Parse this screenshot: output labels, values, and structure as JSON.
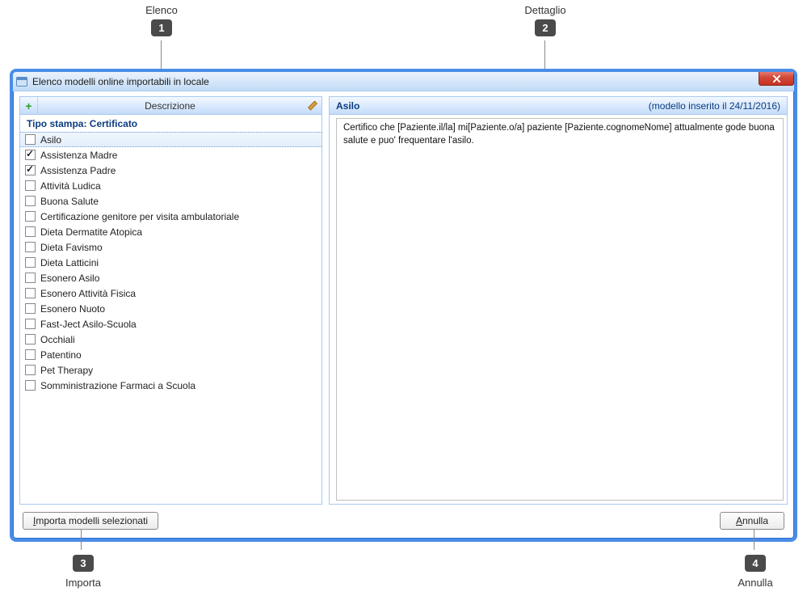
{
  "annotations": {
    "top_left": "Elenco",
    "top_right": "Dettaglio",
    "badge1": "1",
    "badge2": "2",
    "badge3": "3",
    "badge4": "4",
    "bottom_left": "Importa",
    "bottom_right": "Annulla"
  },
  "window": {
    "title": "Elenco modelli online importabili in locale"
  },
  "list": {
    "header": "Descrizione",
    "group_label_prefix": "Tipo stampa: ",
    "group_value": "Certificato",
    "items": [
      {
        "label": "Asilo",
        "checked": false,
        "selected": true
      },
      {
        "label": "Assistenza Madre",
        "checked": true,
        "selected": false
      },
      {
        "label": "Assistenza Padre",
        "checked": true,
        "selected": false
      },
      {
        "label": "Attività  Ludica",
        "checked": false,
        "selected": false
      },
      {
        "label": "Buona Salute",
        "checked": false,
        "selected": false
      },
      {
        "label": "Certificazione genitore per visita ambulatoriale",
        "checked": false,
        "selected": false
      },
      {
        "label": "Dieta Dermatite Atopica",
        "checked": false,
        "selected": false
      },
      {
        "label": "Dieta Favismo",
        "checked": false,
        "selected": false
      },
      {
        "label": "Dieta Latticini",
        "checked": false,
        "selected": false
      },
      {
        "label": "Esonero Asilo",
        "checked": false,
        "selected": false
      },
      {
        "label": "Esonero Attività  Fisica",
        "checked": false,
        "selected": false
      },
      {
        "label": "Esonero Nuoto",
        "checked": false,
        "selected": false
      },
      {
        "label": "Fast-Ject Asilo-Scuola",
        "checked": false,
        "selected": false
      },
      {
        "label": "Occhiali",
        "checked": false,
        "selected": false
      },
      {
        "label": "Patentino",
        "checked": false,
        "selected": false
      },
      {
        "label": "Pet Therapy",
        "checked": false,
        "selected": false
      },
      {
        "label": "Somministrazione Farmaci a Scuola",
        "checked": false,
        "selected": false
      }
    ]
  },
  "detail": {
    "title": "Asilo",
    "meta": "(modello inserito il 24/11/2016)",
    "body": "Certifico che [Paziente.il/la] mi[Paziente.o/a] paziente [Paziente.cognomeNome] attualmente gode buona salute e puo' frequentare l'asilo."
  },
  "buttons": {
    "import_prefix": "I",
    "import_rest": "mporta modelli selezionati",
    "cancel_prefix": "A",
    "cancel_rest": "nnulla"
  }
}
